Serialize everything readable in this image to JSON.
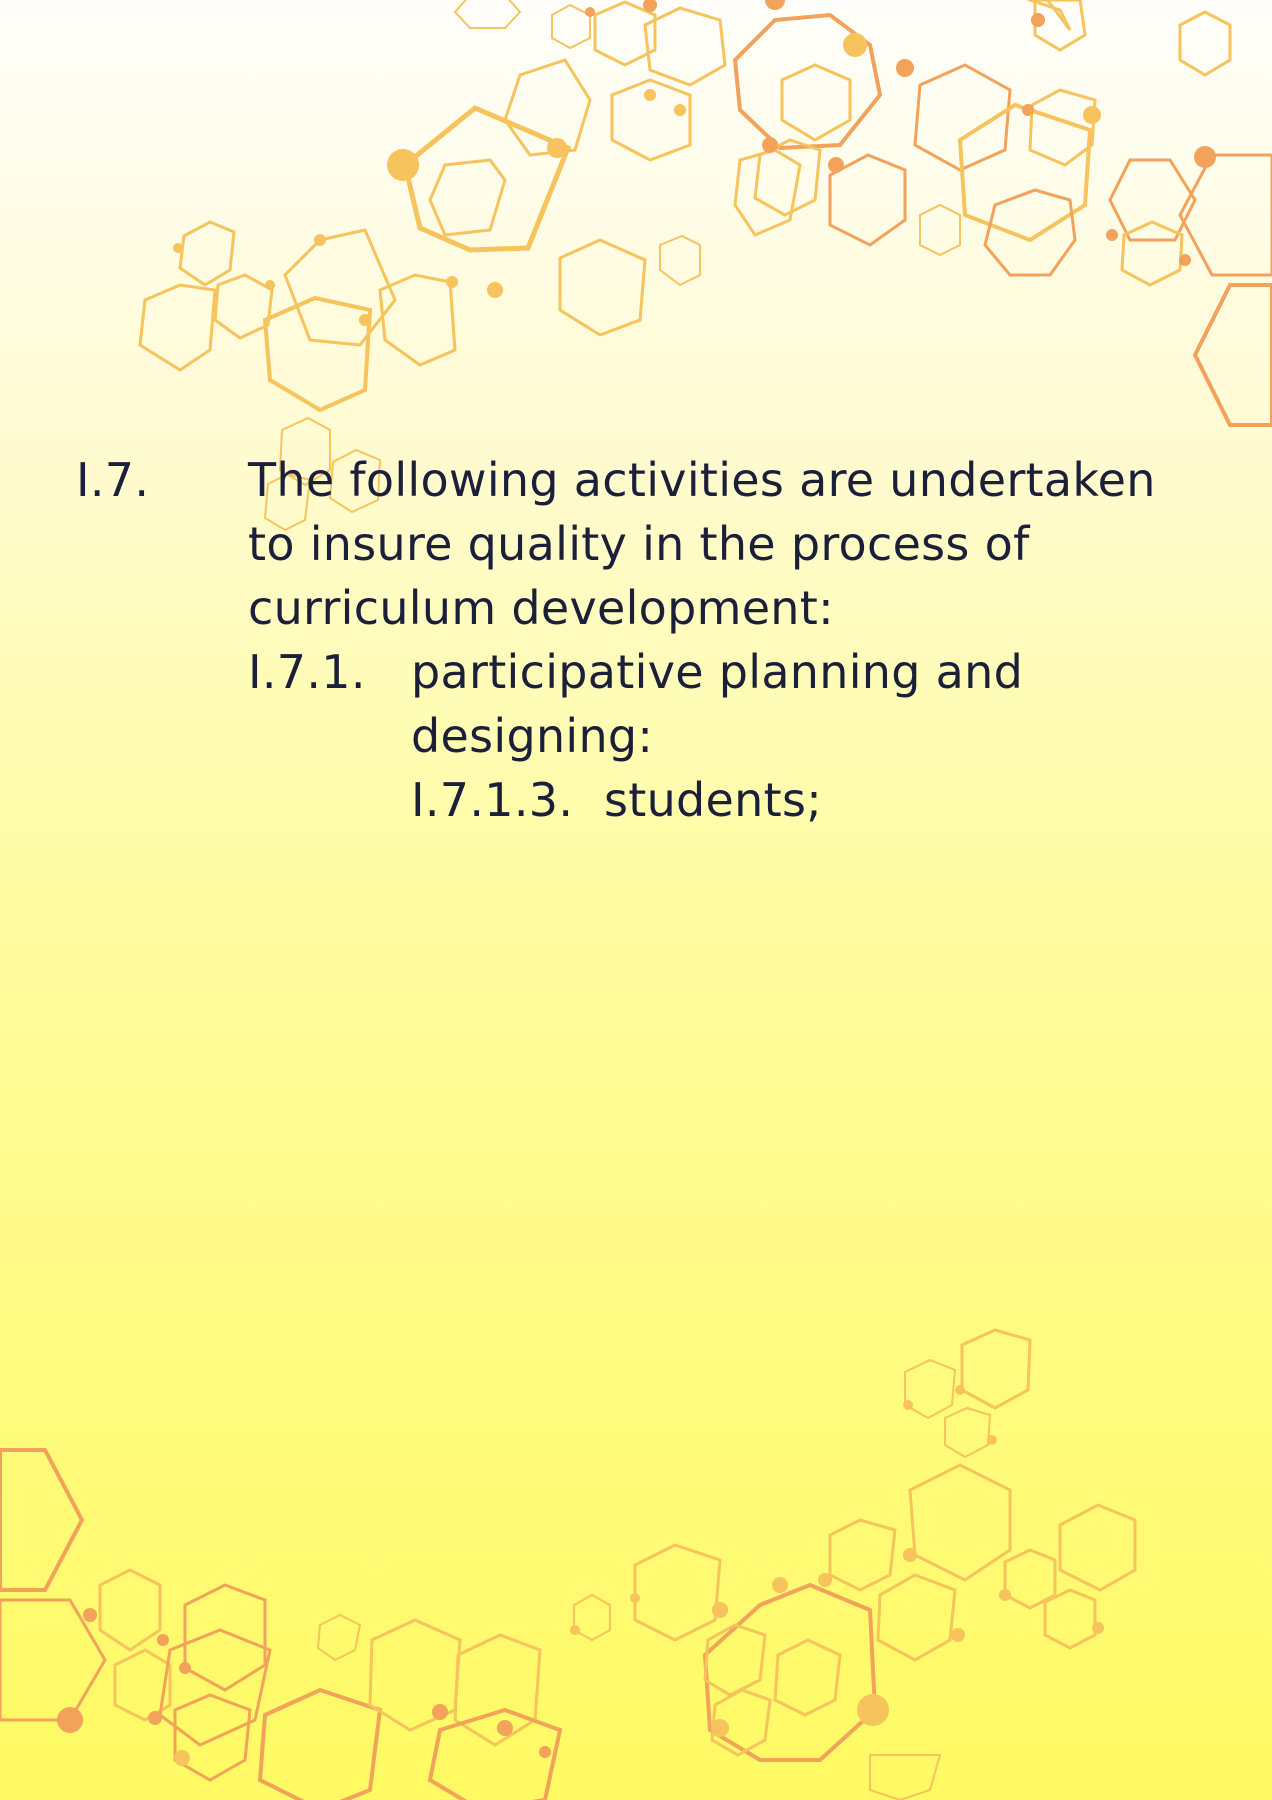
{
  "colors": {
    "text": "#1c1f3a",
    "hex_yellow": "#f6c35c",
    "hex_orange": "#f2a25a",
    "background_top": "#fffefa",
    "background_bottom": "#fffa63"
  },
  "decorations": {
    "top_pattern": "hexagon-network-icon",
    "bottom_pattern": "hexagon-network-icon"
  },
  "section": {
    "number": "I.7.",
    "lines": [
      "The following activities are undertaken",
      "to insure quality in the process of",
      "curriculum development:"
    ],
    "subsection": {
      "number": "I.7.1.",
      "lines": [
        "participative planning and",
        "designing:"
      ],
      "item": {
        "number": "I.7.1.3.",
        "text": "students;"
      }
    }
  }
}
